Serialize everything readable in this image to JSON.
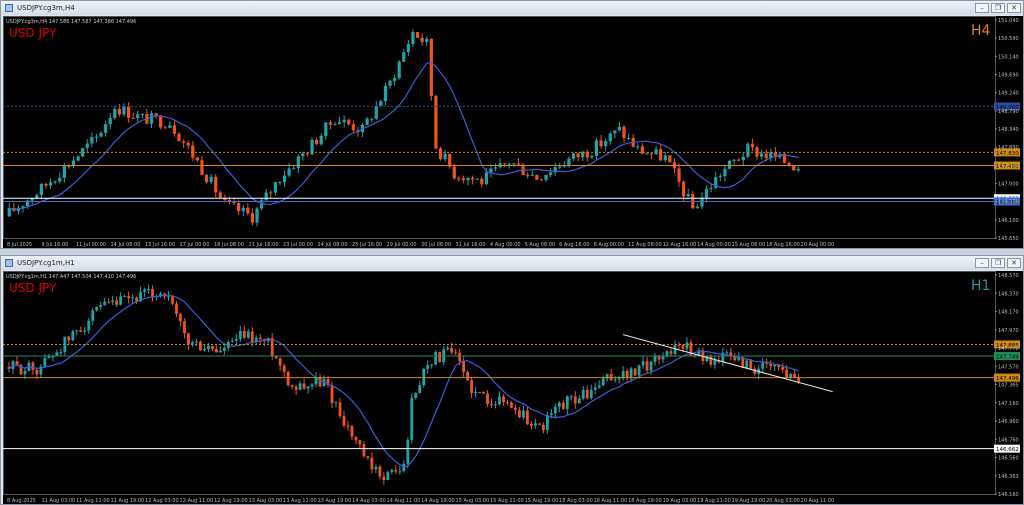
{
  "windows": [
    {
      "title": "USDJPY.cg3m,H4",
      "buttons": [
        "–",
        "❐",
        "✕"
      ]
    },
    {
      "title": "USDJPY.cg1m,H1",
      "buttons": [
        "–",
        "❐",
        "✕"
      ]
    }
  ],
  "colors": {
    "background": "#000000",
    "bull": "#1fa4a9",
    "bear": "#f0541e",
    "ma": "#3e5cd8",
    "symbol_label": "#e00000",
    "tf_h4": "#e08a10",
    "tf_h1": "#1f9aa0"
  },
  "chart_data": [
    {
      "type": "candlestick",
      "symbol_label": "USD JPY",
      "timeframe": "H4",
      "info_line": "USDJPY.cg3m,H4  147.586 147.587 147.386 147.496",
      "ylim": [
        145.65,
        151.2
      ],
      "y_ticks": [
        "151.040",
        "150.590",
        "150.140",
        "149.690",
        "149.240",
        "148.790",
        "148.340",
        "147.890",
        "147.450",
        "147.000",
        "146.550",
        "146.100",
        "145.650"
      ],
      "x_labels": [
        "8 Jul 2025",
        "9 Jul 16:00",
        "11 Jul 00:00",
        "14 Jul 08:00",
        "15 Jul 16:00",
        "17 Jul 00:00",
        "18 Jul 08:00",
        "21 Jul 16:00",
        "23 Jul 00:00",
        "24 Jul 08:00",
        "25 Jul 16:00",
        "29 Jul 00:00",
        "30 Jul 08:00",
        "31 Jul 16:00",
        "4 Aug 00:00",
        "5 Aug 08:00",
        "6 Aug 16:00",
        "8 Aug 00:00",
        "11 Aug 08:00",
        "12 Aug 16:00",
        "14 Aug 00:00",
        "15 Aug 08:00",
        "18 Aug 16:00",
        "20 Aug 00:00"
      ],
      "anchors": [
        [
          0,
          146.2
        ],
        [
          8,
          146.9
        ],
        [
          20,
          148.2
        ],
        [
          24,
          149.0
        ],
        [
          30,
          148.7
        ],
        [
          36,
          148.6
        ],
        [
          42,
          147.6
        ],
        [
          48,
          146.5
        ],
        [
          54,
          146.2
        ],
        [
          60,
          147.2
        ],
        [
          66,
          147.9
        ],
        [
          72,
          148.7
        ],
        [
          78,
          148.4
        ],
        [
          84,
          149.6
        ],
        [
          89,
          150.9
        ],
        [
          92,
          150.6
        ],
        [
          94,
          148.0
        ],
        [
          98,
          147.3
        ],
        [
          104,
          147.1
        ],
        [
          110,
          147.6
        ],
        [
          116,
          147.2
        ],
        [
          122,
          147.6
        ],
        [
          128,
          147.9
        ],
        [
          134,
          148.4
        ],
        [
          138,
          147.9
        ],
        [
          144,
          147.7
        ],
        [
          150,
          146.4
        ],
        [
          156,
          147.3
        ],
        [
          162,
          147.9
        ],
        [
          168,
          147.7
        ],
        [
          172,
          147.5
        ]
      ],
      "candle_count": 173,
      "levels": [
        {
          "price": 149.0,
          "label": "149.000",
          "line": "#2c4d9a",
          "box": "#2c4d9a",
          "style": "dotted"
        },
        {
          "price": 147.83,
          "label": "147.830",
          "line": "#d08a10",
          "box": "#d08a10",
          "style": "dotted"
        },
        {
          "price": 147.496,
          "label": "147.496",
          "line": "#d08a10",
          "box": "#d08a10",
          "style": "solid"
        },
        {
          "price": 146.662,
          "label": "146.662",
          "line": "#ffffff",
          "box": "#ffffff",
          "style": "solid"
        },
        {
          "price": 146.58,
          "label": "146.580",
          "line": "#3a6fd8",
          "box": "#3a6fd8",
          "style": "solid"
        }
      ],
      "trendline": null
    },
    {
      "type": "candlestick",
      "symbol_label": "USD JPY",
      "timeframe": "H1",
      "info_line": "USDJPY.cg1m,H1  147.447 147.504 147.410 147.496",
      "ylim": [
        146.13,
        148.7
      ],
      "y_ticks": [
        "148.570",
        "148.370",
        "148.170",
        "147.970",
        "147.770",
        "147.570",
        "147.365",
        "147.160",
        "146.960",
        "146.760",
        "146.560",
        "146.363",
        "146.160"
      ],
      "x_labels": [
        "8 Aug 2025",
        "11 Aug 03:00",
        "11 Aug 11:00",
        "11 Aug 19:00",
        "12 Aug 03:00",
        "12 Aug 11:00",
        "12 Aug 19:00",
        "13 Aug 03:00",
        "13 Aug 11:00",
        "13 Aug 19:00",
        "14 Aug 03:00",
        "14 Aug 11:00",
        "14 Aug 19:00",
        "15 Aug 03:00",
        "15 Aug 11:00",
        "15 Aug 19:00",
        "18 Aug 03:00",
        "18 Aug 11:00",
        "18 Aug 19:00",
        "19 Aug 03:00",
        "19 Aug 11:00",
        "19 Aug 19:00",
        "20 Aug 03:00",
        "20 Aug 11:00"
      ],
      "anchors": [
        [
          0,
          147.62
        ],
        [
          8,
          147.6
        ],
        [
          16,
          147.95
        ],
        [
          24,
          148.3
        ],
        [
          34,
          148.45
        ],
        [
          40,
          148.5
        ],
        [
          46,
          147.9
        ],
        [
          54,
          147.8
        ],
        [
          60,
          148.0
        ],
        [
          66,
          147.9
        ],
        [
          72,
          147.4
        ],
        [
          80,
          147.45
        ],
        [
          86,
          146.9
        ],
        [
          92,
          146.4
        ],
        [
          96,
          146.35
        ],
        [
          100,
          146.45
        ],
        [
          102,
          147.2
        ],
        [
          106,
          147.7
        ],
        [
          112,
          147.8
        ],
        [
          118,
          147.3
        ],
        [
          126,
          147.2
        ],
        [
          134,
          146.9
        ],
        [
          140,
          147.2
        ],
        [
          146,
          147.3
        ],
        [
          152,
          147.5
        ],
        [
          158,
          147.55
        ],
        [
          164,
          147.75
        ],
        [
          170,
          147.9
        ],
        [
          176,
          147.7
        ],
        [
          182,
          147.75
        ],
        [
          188,
          147.6
        ],
        [
          194,
          147.6
        ],
        [
          198,
          147.5
        ]
      ],
      "candle_count": 199,
      "levels": [
        {
          "price": 147.885,
          "label": "147.885",
          "line": "#d08a10",
          "box": "#d08a10",
          "style": "dotted"
        },
        {
          "price": 147.749,
          "label": "147.749",
          "line": "#1f8f5a",
          "box": "#1f8f5a",
          "style": "solid"
        },
        {
          "price": 147.496,
          "label": "147.496",
          "line": "#d08a10",
          "box": "#d08a10",
          "style": "solid"
        },
        {
          "price": 146.662,
          "label": "146.662",
          "line": "#ffffff",
          "box": "#ffffff",
          "style": "solid"
        }
      ],
      "trendline": {
        "from": [
          154,
          148.0
        ],
        "to": [
          199,
          147.39
        ]
      }
    }
  ]
}
